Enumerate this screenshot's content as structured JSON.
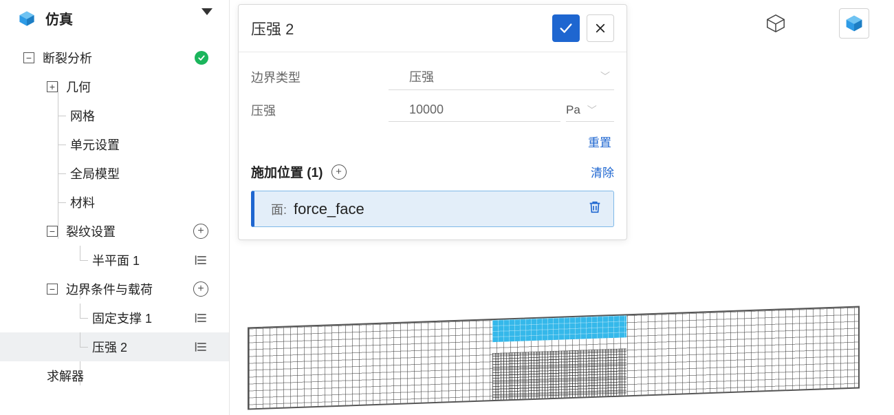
{
  "brand": {
    "title": "仿真"
  },
  "tree": {
    "root": {
      "label": "断裂分析",
      "status": "ok"
    },
    "geometry": {
      "label": "几何"
    },
    "mesh": {
      "label": "网格"
    },
    "element": {
      "label": "单元设置"
    },
    "global": {
      "label": "全局模型"
    },
    "material": {
      "label": "材料"
    },
    "crack": {
      "label": "裂纹设置"
    },
    "halfplane1": {
      "label": "半平面 1"
    },
    "bc": {
      "label": "边界条件与载荷"
    },
    "fixed1": {
      "label": "固定支撑 1"
    },
    "pressure2": {
      "label": "压强 2"
    },
    "solver": {
      "label": "求解器"
    }
  },
  "panel": {
    "title": "压强 2",
    "bc_type_label": "边界类型",
    "bc_type_value": "压强",
    "pressure_label": "压强",
    "pressure_value": "10000",
    "pressure_unit": "Pa",
    "reset": "重置",
    "section_title": "施加位置 (1)",
    "clear": "清除",
    "assign_prefix": "面:",
    "assign_value": "force_face"
  }
}
